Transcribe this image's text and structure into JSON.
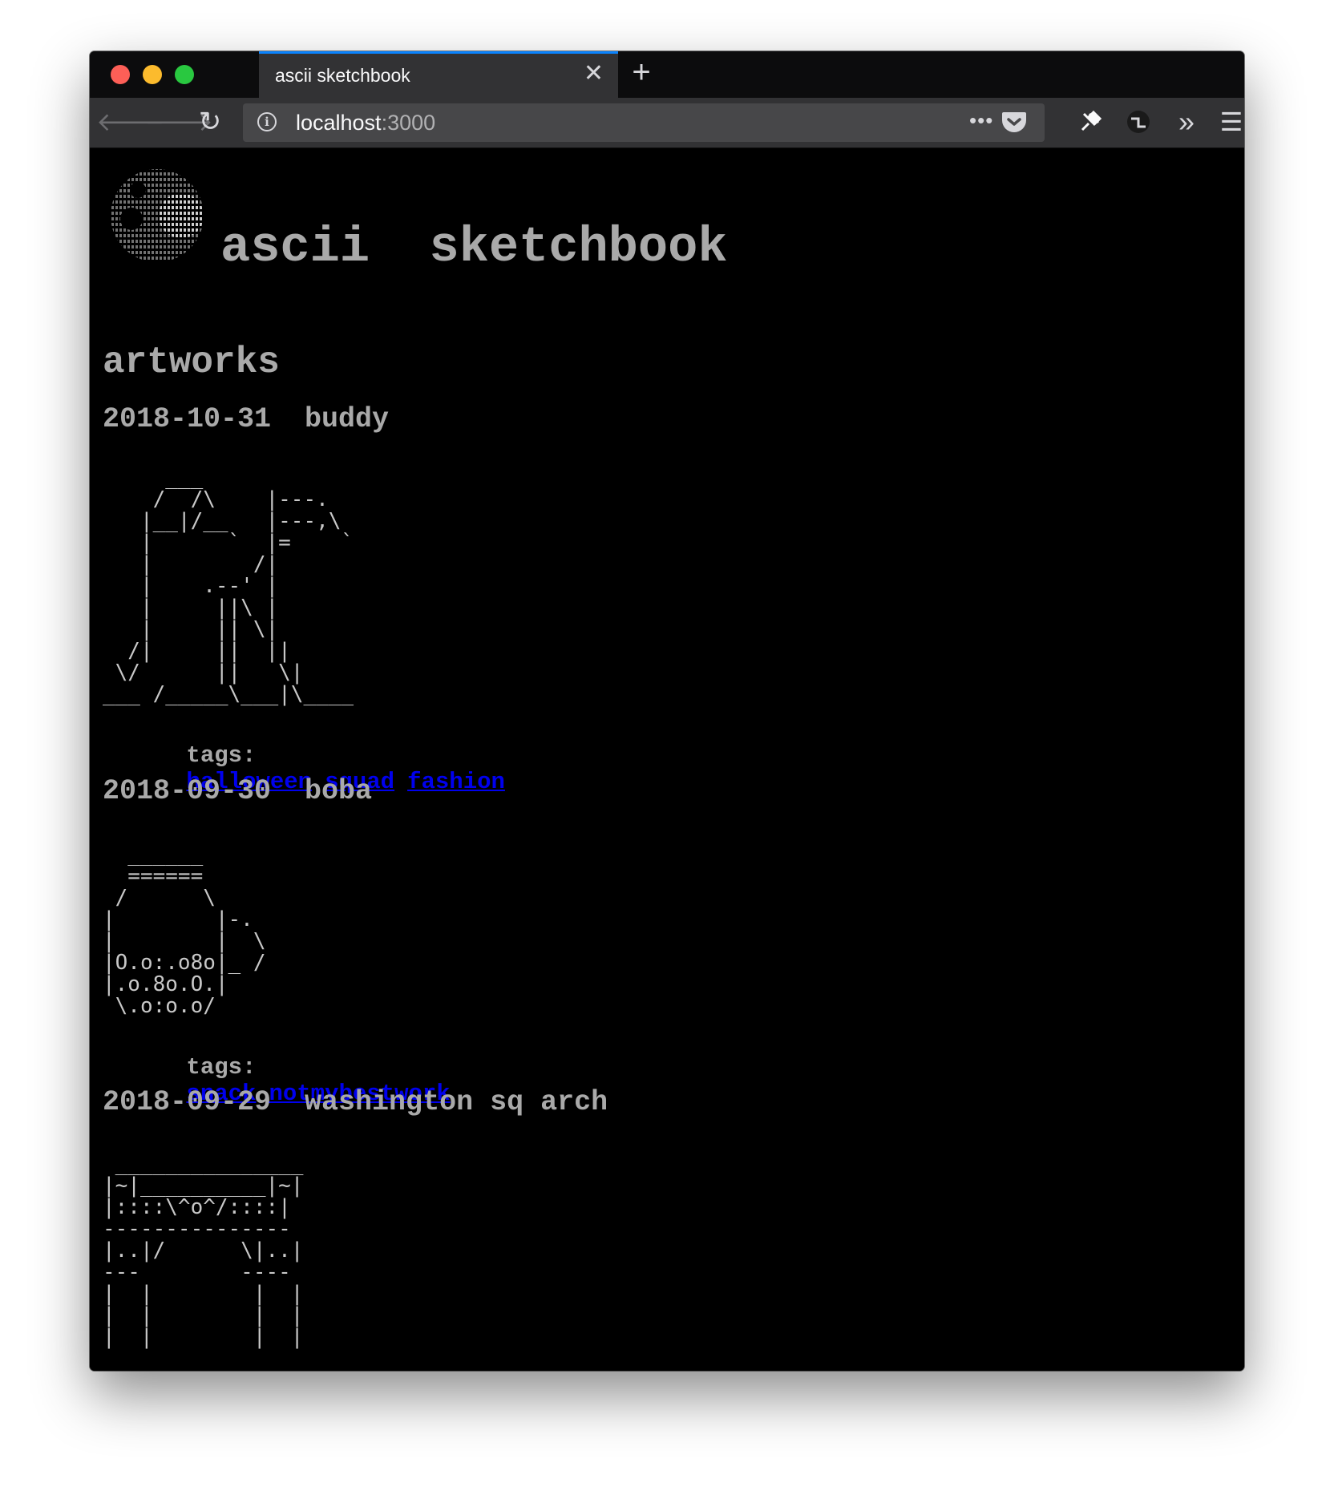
{
  "browser": {
    "tab_title": "ascii sketchbook",
    "tab_close": "✕",
    "new_tab": "+",
    "url_host": "localhost",
    "url_port": ":3000",
    "accent_color": "#0a84ff"
  },
  "page": {
    "site_title": "ascii  sketchbook",
    "section_title": "artworks",
    "tags_label": "tags:",
    "link_color": "#0000ee",
    "artworks": [
      {
        "title": "2018-10-31  buddy",
        "art": "     ___\n    /  /\\    |---.\n   |__|/__   |---,\\\n   |      `  |=    `\n   |        /|\n   |    .--' |\n   |     ||\\ |\n   |     || \\|\n  /|     ||  ||\n \\/      ||   \\|\n___ /_____\\___|\\____",
        "tags": [
          "halloween",
          "squad",
          "fashion"
        ]
      },
      {
        "title": "2018-09-30  boba",
        "art": "  ______\n  ======\n /      \\\n|        |-.\n|        |  \\\n|O.o:.o8o|_ /\n|.o.8o.O.|\n \\.o:o.o/",
        "tags": [
          "snack",
          "notmybestwork"
        ]
      },
      {
        "title": "2018-09-29  washington sq arch",
        "art": " _______________\n|~|__________|~|\n|::::\\^o^/::::|\n---------------\n|..|/      \\|..|\n---        ----\n|  |        |  |\n|  |        |  |\n|  |        |  |",
        "tags": []
      }
    ]
  }
}
